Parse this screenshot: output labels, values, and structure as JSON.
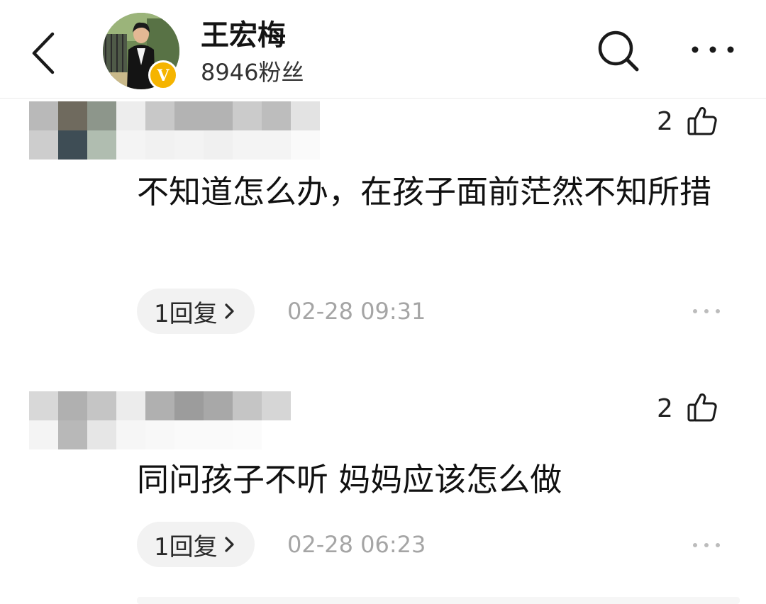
{
  "header": {
    "name": "王宏梅",
    "fans": "8946粉丝",
    "back_icon": "chevron-left-icon",
    "search_icon": "search-icon",
    "more_icon": "more-horizontal-icon",
    "badge_icon": "verified-v-icon",
    "badge_letter": "V",
    "badge_color": "#f5b400"
  },
  "comments": [
    {
      "likes": "2",
      "text": "不知道怎么办，在孩子面前茫然不知所措",
      "reply": "1回复",
      "time": "02-28 09:31"
    },
    {
      "likes": "2",
      "text": "同问孩子不听 妈妈应该怎么做",
      "reply": "1回复",
      "time": "02-28 06:23"
    }
  ],
  "colors": {
    "text": "#111111",
    "time": "#a5a5a5",
    "pill": "#f2f2f2",
    "divider": "#ececec"
  }
}
